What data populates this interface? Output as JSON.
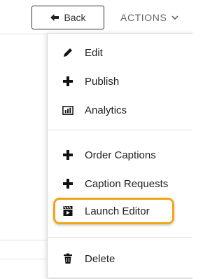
{
  "toolbar": {
    "back_label": "Back",
    "actions_label": "ACTIONS"
  },
  "menu": {
    "items": [
      {
        "label": "Edit",
        "icon": "pencil-icon"
      },
      {
        "label": "Publish",
        "icon": "plus-icon"
      },
      {
        "label": "Analytics",
        "icon": "analytics-icon"
      },
      {
        "label": "Order Captions",
        "icon": "plus-icon"
      },
      {
        "label": "Caption Requests",
        "icon": "plus-icon"
      },
      {
        "label": "Launch Editor",
        "icon": "video-editor-icon",
        "highlighted": true
      },
      {
        "label": "Delete",
        "icon": "trash-icon"
      }
    ]
  },
  "colors": {
    "highlight": "#f2a516",
    "text": "#1f1f1f",
    "muted": "#666666"
  }
}
